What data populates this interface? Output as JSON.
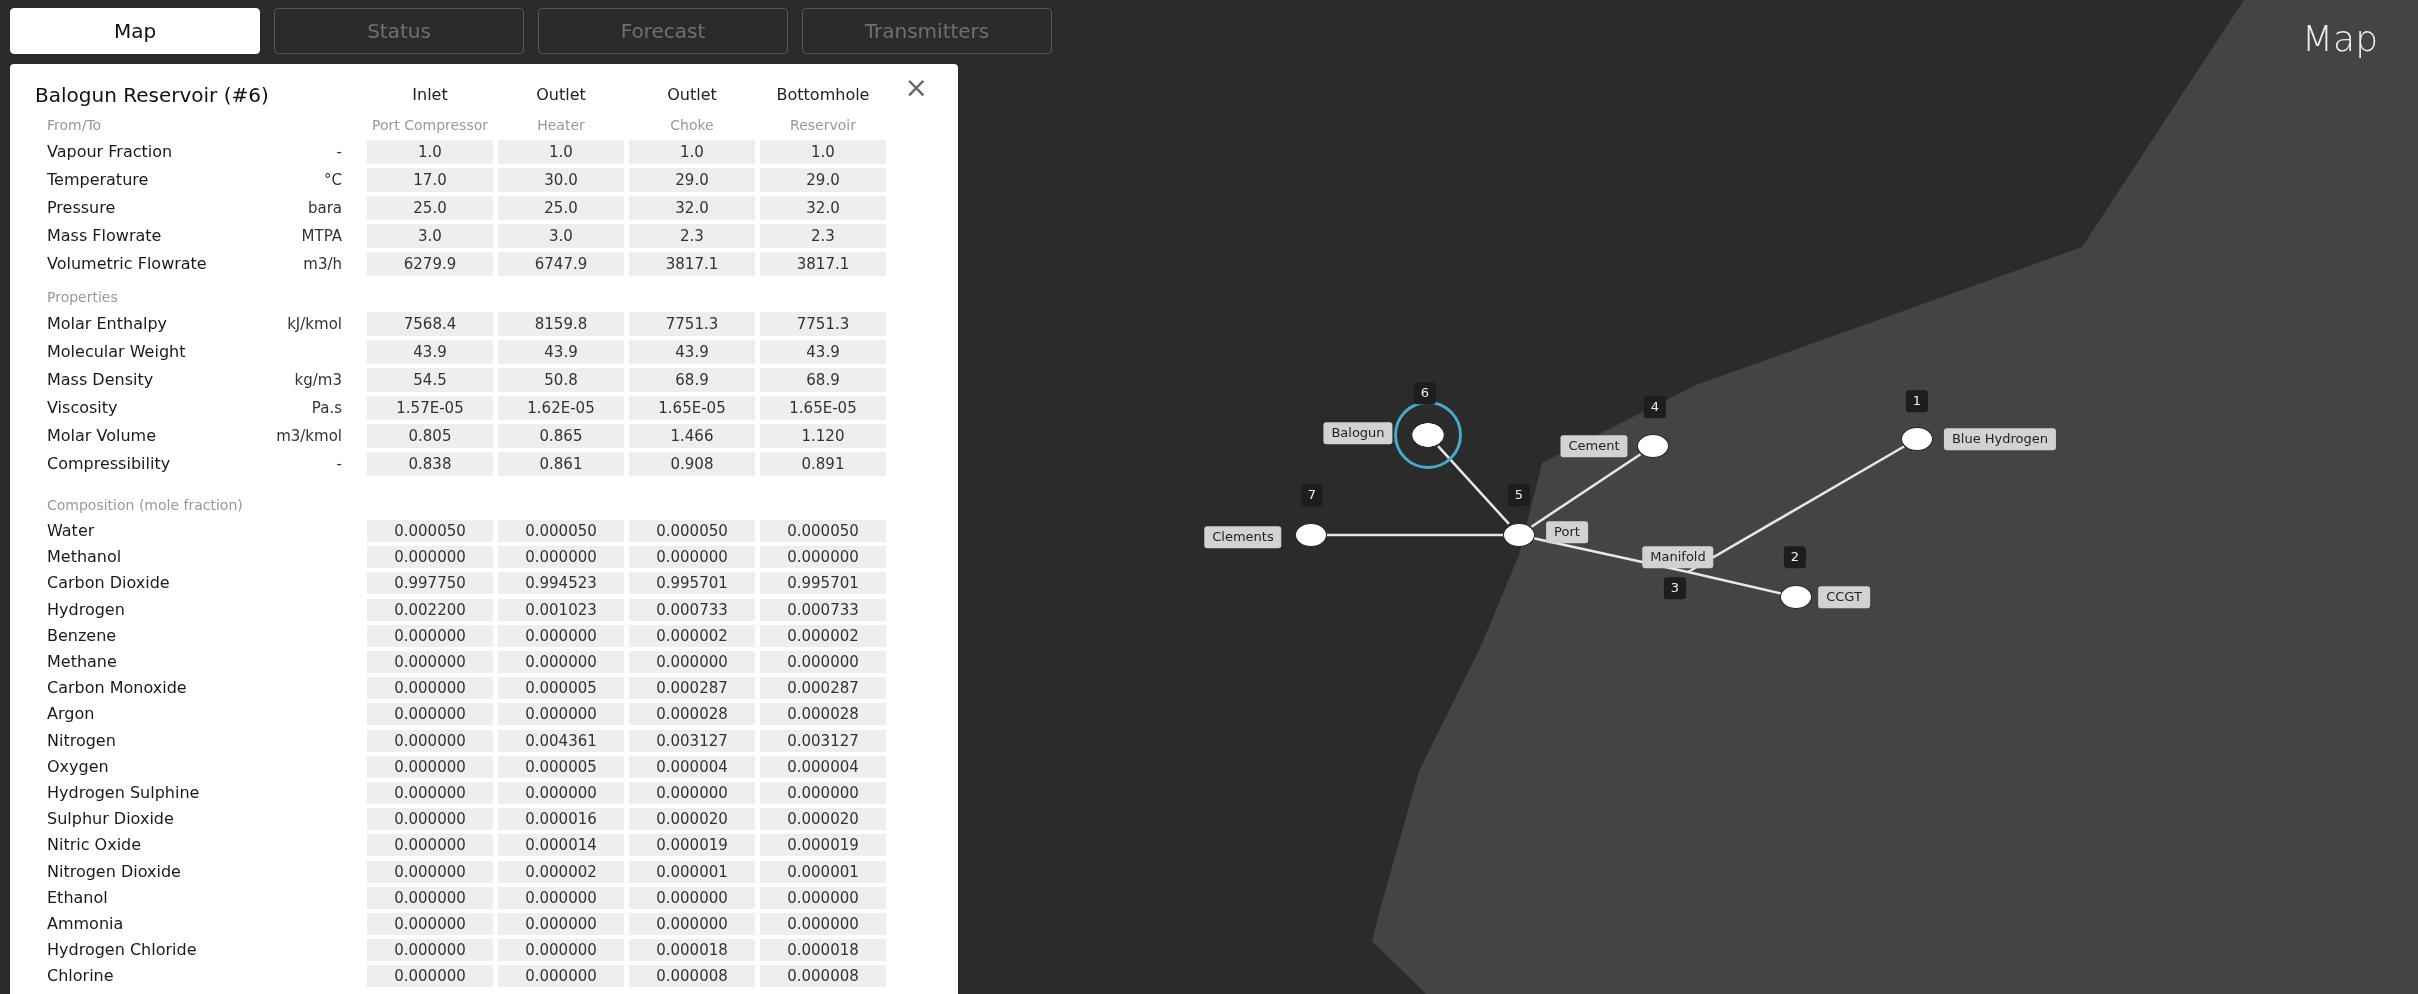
{
  "tabs": [
    {
      "label": "Map",
      "selected": true
    },
    {
      "label": "Status",
      "selected": false
    },
    {
      "label": "Forecast",
      "selected": false
    },
    {
      "label": "Transmitters",
      "selected": false
    }
  ],
  "map_title": "Map",
  "panel": {
    "title": "Balogun Reservoir (#6)",
    "close": "×",
    "from_to_label": "From/To",
    "columns": [
      {
        "position": "Inlet",
        "from_to": "Port Compressor"
      },
      {
        "position": "Outlet",
        "from_to": "Heater"
      },
      {
        "position": "Outlet",
        "from_to": "Choke"
      },
      {
        "position": "Bottomhole",
        "from_to": "Reservoir"
      }
    ],
    "stream_rows": [
      {
        "name": "Vapour Fraction",
        "unit": "-",
        "values": [
          "1.0",
          "1.0",
          "1.0",
          "1.0"
        ]
      },
      {
        "name": "Temperature",
        "unit": "°C",
        "values": [
          "17.0",
          "30.0",
          "29.0",
          "29.0"
        ]
      },
      {
        "name": "Pressure",
        "unit": "bara",
        "values": [
          "25.0",
          "25.0",
          "32.0",
          "32.0"
        ]
      },
      {
        "name": "Mass Flowrate",
        "unit": "MTPA",
        "values": [
          "3.0",
          "3.0",
          "2.3",
          "2.3"
        ]
      },
      {
        "name": "Volumetric Flowrate",
        "unit": "m3/h",
        "values": [
          "6279.9",
          "6747.9",
          "3817.1",
          "3817.1"
        ]
      }
    ],
    "properties_heading": "Properties",
    "property_rows": [
      {
        "name": "Molar Enthalpy",
        "unit": "kJ/kmol",
        "values": [
          "7568.4",
          "8159.8",
          "7751.3",
          "7751.3"
        ]
      },
      {
        "name": "Molecular Weight",
        "values": [
          "43.9",
          "43.9",
          "43.9",
          "43.9"
        ]
      },
      {
        "name": "Mass Density",
        "unit": "kg/m3",
        "values": [
          "54.5",
          "50.8",
          "68.9",
          "68.9"
        ]
      },
      {
        "name": "Viscosity",
        "unit": "Pa.s",
        "values": [
          "1.57E-05",
          "1.62E-05",
          "1.65E-05",
          "1.65E-05"
        ]
      },
      {
        "name": "Molar Volume",
        "unit": "m3/kmol",
        "values": [
          "0.805",
          "0.865",
          "1.466",
          "1.120"
        ]
      },
      {
        "name": "Compressibility",
        "unit": "-",
        "values": [
          "0.838",
          "0.861",
          "0.908",
          "0.891"
        ]
      }
    ],
    "composition_heading": "Composition (mole fraction)",
    "composition_rows": [
      {
        "name": "Water",
        "values": [
          "0.000050",
          "0.000050",
          "0.000050",
          "0.000050"
        ]
      },
      {
        "name": "Methanol",
        "values": [
          "0.000000",
          "0.000000",
          "0.000000",
          "0.000000"
        ]
      },
      {
        "name": "Carbon Dioxide",
        "values": [
          "0.997750",
          "0.994523",
          "0.995701",
          "0.995701"
        ]
      },
      {
        "name": "Hydrogen",
        "values": [
          "0.002200",
          "0.001023",
          "0.000733",
          "0.000733"
        ]
      },
      {
        "name": "Benzene",
        "values": [
          "0.000000",
          "0.000000",
          "0.000002",
          "0.000002"
        ]
      },
      {
        "name": "Methane",
        "values": [
          "0.000000",
          "0.000000",
          "0.000000",
          "0.000000"
        ]
      },
      {
        "name": "Carbon Monoxide",
        "values": [
          "0.000000",
          "0.000005",
          "0.000287",
          "0.000287"
        ]
      },
      {
        "name": "Argon",
        "values": [
          "0.000000",
          "0.000000",
          "0.000028",
          "0.000028"
        ]
      },
      {
        "name": "Nitrogen",
        "values": [
          "0.000000",
          "0.004361",
          "0.003127",
          "0.003127"
        ]
      },
      {
        "name": "Oxygen",
        "values": [
          "0.000000",
          "0.000005",
          "0.000004",
          "0.000004"
        ]
      },
      {
        "name": "Hydrogen Sulphine",
        "values": [
          "0.000000",
          "0.000000",
          "0.000000",
          "0.000000"
        ]
      },
      {
        "name": "Sulphur Dioxide",
        "values": [
          "0.000000",
          "0.000016",
          "0.000020",
          "0.000020"
        ]
      },
      {
        "name": "Nitric Oxide",
        "values": [
          "0.000000",
          "0.000014",
          "0.000019",
          "0.000019"
        ]
      },
      {
        "name": "Nitrogen Dioxide",
        "values": [
          "0.000000",
          "0.000002",
          "0.000001",
          "0.000001"
        ]
      },
      {
        "name": "Ethanol",
        "values": [
          "0.000000",
          "0.000000",
          "0.000000",
          "0.000000"
        ]
      },
      {
        "name": "Ammonia",
        "values": [
          "0.000000",
          "0.000000",
          "0.000000",
          "0.000000"
        ]
      },
      {
        "name": "Hydrogen Chloride",
        "values": [
          "0.000000",
          "0.000000",
          "0.000018",
          "0.000018"
        ]
      },
      {
        "name": "Chlorine",
        "values": [
          "0.000000",
          "0.000000",
          "0.000008",
          "0.000008"
        ]
      }
    ]
  },
  "nodes": [
    {
      "number": "7",
      "label": "Clements",
      "kind": "site",
      "selected": false
    },
    {
      "number": "6",
      "label": "Balogun",
      "kind": "site",
      "selected": true
    },
    {
      "number": "5",
      "label": "Port",
      "kind": "site",
      "selected": false
    },
    {
      "number": "4",
      "label": "Cement",
      "kind": "site",
      "selected": false
    },
    {
      "number": "3",
      "label": "Manifold",
      "kind": "junction",
      "selected": false
    },
    {
      "number": "2",
      "label": "CCGT",
      "kind": "site",
      "selected": false
    },
    {
      "number": "1",
      "label": "Blue Hydrogen",
      "kind": "site",
      "selected": false
    }
  ]
}
